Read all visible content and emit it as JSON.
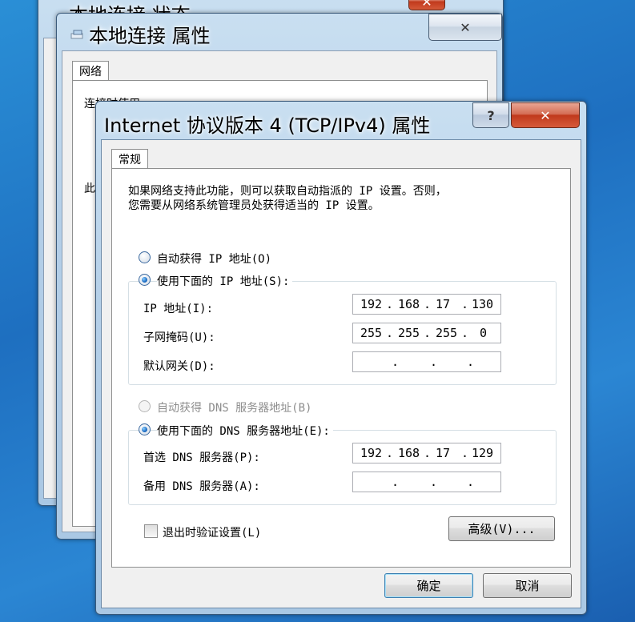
{
  "window_status": {
    "title": "本地连接 状态"
  },
  "window_props": {
    "title": "本地连接 属性",
    "tab": "网络",
    "connect_using_label": "连接时使用:",
    "partial_label": "此"
  },
  "tcpip": {
    "title": "Internet 协议版本 4 (TCP/IPv4) 属性",
    "help_label": "?",
    "close_label": "✕",
    "tab": "常规",
    "description_line1": "如果网络支持此功能，则可以获取自动指派的 IP 设置。否则，",
    "description_line2": "您需要从网络系统管理员处获得适当的 IP 设置。",
    "radio_auto_ip": "自动获得 IP 地址(O)",
    "radio_manual_ip": "使用下面的 IP 地址(S):",
    "ip_label": "IP 地址(I):",
    "ip_value": [
      "192",
      "168",
      "17",
      "130"
    ],
    "mask_label": "子网掩码(U):",
    "mask_value": [
      "255",
      "255",
      "255",
      "0"
    ],
    "gateway_label": "默认网关(D):",
    "gateway_value": [
      "",
      "",
      "",
      ""
    ],
    "radio_auto_dns": "自动获得 DNS 服务器地址(B)",
    "radio_manual_dns": "使用下面的 DNS 服务器地址(E):",
    "dns_pref_label": "首选 DNS 服务器(P):",
    "dns_pref_value": [
      "192",
      "168",
      "17",
      "129"
    ],
    "dns_alt_label": "备用 DNS 服务器(A):",
    "dns_alt_value": [
      "",
      "",
      "",
      ""
    ],
    "validate_label": "退出时验证设置(L)",
    "advanced_label": "高级(V)...",
    "ok_label": "确定",
    "cancel_label": "取消"
  }
}
